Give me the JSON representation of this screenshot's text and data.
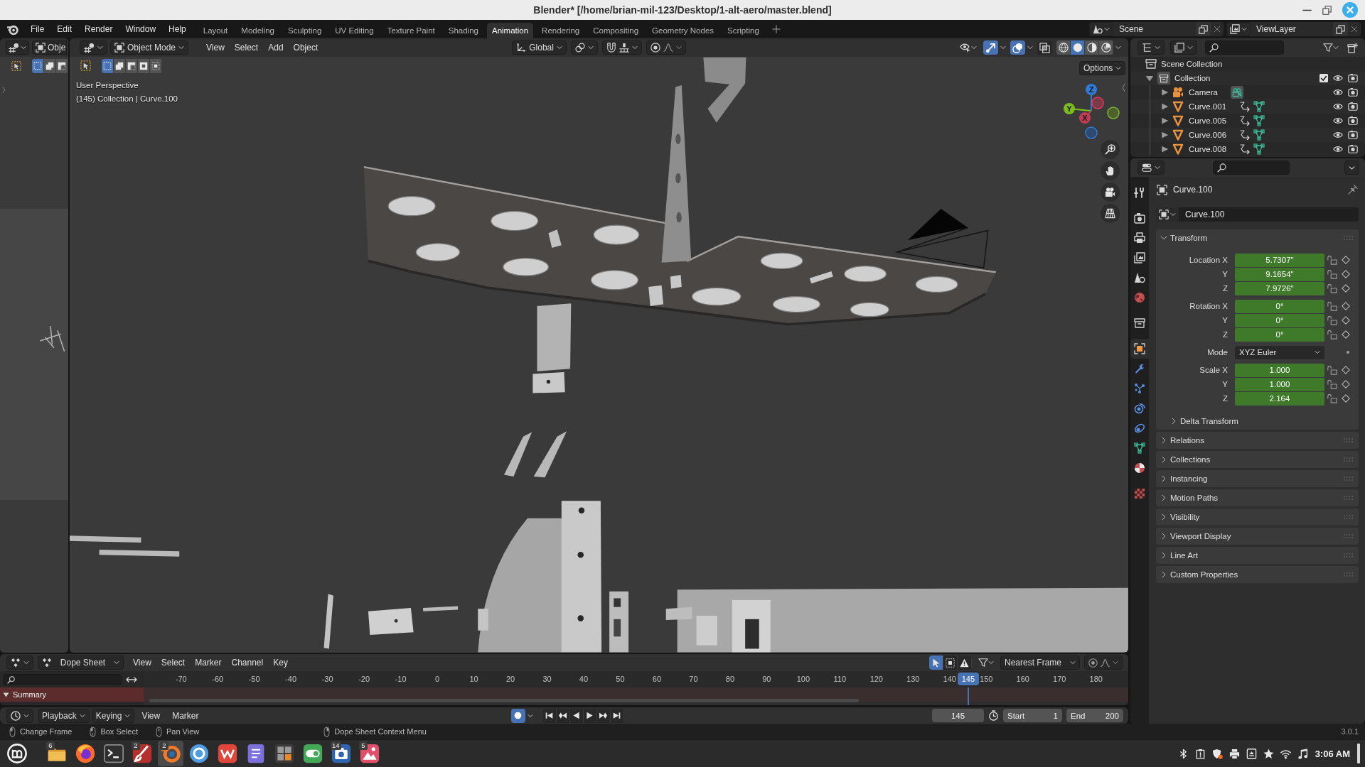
{
  "title_bar": {
    "title": "Blender* [/home/brian-mil-123/Desktop/1-alt-aero/master.blend]"
  },
  "top_bar": {
    "menus": [
      "File",
      "Edit",
      "Render",
      "Window",
      "Help"
    ],
    "workspaces": [
      {
        "label": "Layout",
        "selected": false
      },
      {
        "label": "Modeling",
        "selected": false
      },
      {
        "label": "Sculpting",
        "selected": false
      },
      {
        "label": "UV Editing",
        "selected": false
      },
      {
        "label": "Texture Paint",
        "selected": false
      },
      {
        "label": "Shading",
        "selected": false
      },
      {
        "label": "Animation",
        "selected": true
      },
      {
        "label": "Rendering",
        "selected": false
      },
      {
        "label": "Compositing",
        "selected": false
      },
      {
        "label": "Geometry Nodes",
        "selected": false
      },
      {
        "label": "Scripting",
        "selected": false
      }
    ],
    "scene": "Scene",
    "view_layer": "ViewLayer"
  },
  "side_viewport": {
    "mode": "Obje",
    "select_modes": [
      {
        "selected": true
      },
      {
        "selected": false
      },
      {
        "selected": false
      }
    ]
  },
  "viewport": {
    "mode": "Object Mode",
    "menus": [
      "View",
      "Select",
      "Add",
      "Object"
    ],
    "orientation": "Global",
    "select_modes": [
      {
        "selected": true
      },
      {
        "selected": false
      },
      {
        "selected": false
      },
      {
        "selected": false
      },
      {
        "selected": false
      }
    ],
    "gizmos": true,
    "overlays": true,
    "xray": false,
    "shading": [
      {
        "kind": "wireframe",
        "selected": false
      },
      {
        "kind": "solid",
        "selected": true
      },
      {
        "kind": "material",
        "selected": false
      },
      {
        "kind": "rendered",
        "selected": false
      }
    ],
    "options": "Options",
    "view_name": "User Perspective",
    "view_info": "(145) Collection | Curve.100",
    "axis_labels": [
      "Z",
      "Y",
      "X"
    ]
  },
  "outliner": {
    "root": "Scene Collection",
    "items": [
      {
        "name": "Collection",
        "kind": "collection",
        "expanded": true,
        "checked": true,
        "children": [
          {
            "name": "Camera",
            "kind": "camera",
            "expanded": false
          },
          {
            "name": "Curve.001",
            "kind": "curve",
            "expanded": false
          },
          {
            "name": "Curve.005",
            "kind": "curve",
            "expanded": false
          },
          {
            "name": "Curve.006",
            "kind": "curve",
            "expanded": false
          },
          {
            "name": "Curve.008",
            "kind": "curve",
            "expanded": false
          }
        ]
      }
    ]
  },
  "properties": {
    "tabs": [
      {
        "kind": "tool",
        "selected": false
      },
      {
        "kind": "render",
        "selected": false
      },
      {
        "kind": "output",
        "selected": false
      },
      {
        "kind": "view_layer",
        "selected": false
      },
      {
        "kind": "scene",
        "selected": false
      },
      {
        "kind": "world",
        "selected": false
      },
      {
        "kind": "collection",
        "selected": false
      },
      {
        "kind": "object",
        "selected": true
      },
      {
        "kind": "modifiers",
        "selected": false
      },
      {
        "kind": "particles",
        "selected": false
      },
      {
        "kind": "physics",
        "selected": false
      },
      {
        "kind": "constraints",
        "selected": false
      },
      {
        "kind": "data",
        "selected": false
      },
      {
        "kind": "material",
        "selected": false
      },
      {
        "kind": "texture",
        "selected": false
      }
    ],
    "object_name": "Curve.100",
    "name_field": "Curve.100",
    "transform": {
      "title": "Transform",
      "expanded": true,
      "groups": [
        {
          "rows": [
            {
              "label": "Location X",
              "value": "5.7307\"",
              "kind": "number"
            },
            {
              "label": "Y",
              "value": "9.1654\"",
              "kind": "number"
            },
            {
              "label": "Z",
              "value": "7.9726\"",
              "kind": "number"
            }
          ]
        },
        {
          "rows": [
            {
              "label": "Rotation X",
              "value": "0°",
              "kind": "number"
            },
            {
              "label": "Y",
              "value": "0°",
              "kind": "number"
            },
            {
              "label": "Z",
              "value": "0°",
              "kind": "number"
            }
          ]
        },
        {
          "rows": [
            {
              "label": "Mode",
              "value": "XYZ Euler",
              "kind": "dropdown"
            }
          ]
        },
        {
          "rows": [
            {
              "label": "Scale X",
              "value": "1.000",
              "kind": "number"
            },
            {
              "label": "Y",
              "value": "1.000",
              "kind": "number"
            },
            {
              "label": "Z",
              "value": "2.164",
              "kind": "number"
            }
          ]
        }
      ],
      "subpanels": [
        {
          "title": "Delta Transform",
          "expanded": false
        }
      ]
    },
    "panels": [
      {
        "title": "Relations",
        "expanded": false
      },
      {
        "title": "Collections",
        "expanded": false
      },
      {
        "title": "Instancing",
        "expanded": false
      },
      {
        "title": "Motion Paths",
        "expanded": false
      },
      {
        "title": "Visibility",
        "expanded": false
      },
      {
        "title": "Viewport Display",
        "expanded": false
      },
      {
        "title": "Line Art",
        "expanded": false
      },
      {
        "title": "Custom Properties",
        "expanded": false
      }
    ]
  },
  "dope_sheet": {
    "mode": "Dope Sheet",
    "menus": [
      "View",
      "Select",
      "Marker",
      "Channel",
      "Key"
    ],
    "only_selected": true,
    "snap": "Nearest Frame",
    "channels": [
      {
        "name": "Summary",
        "expanded": true
      }
    ],
    "ruler": [
      "-70",
      "-60",
      "-50",
      "-40",
      "-30",
      "-20",
      "-10",
      "0",
      "10",
      "20",
      "30",
      "40",
      "50",
      "60",
      "70",
      "80",
      "90",
      "100",
      "110",
      "120",
      "130",
      "140",
      "150",
      "160",
      "170",
      "180"
    ],
    "playhead": {
      "label": "145",
      "level": 0.8375
    }
  },
  "timeline": {
    "menus": [
      {
        "label": "Playback",
        "kind": "dropdown"
      },
      {
        "label": "Keying",
        "kind": "dropdown"
      },
      {
        "label": "View",
        "kind": "menu"
      },
      {
        "label": "Marker",
        "kind": "menu"
      }
    ],
    "auto_keying": true,
    "current_frame": "145",
    "start_label": "Start",
    "start": "1",
    "end_label": "End",
    "end": "200"
  },
  "status_bar": {
    "hints": [
      {
        "kind": "left_click",
        "label": "Change Frame"
      },
      {
        "kind": "left_drag",
        "label": "Box Select"
      },
      {
        "kind": "middle_drag",
        "label": "Pan View"
      },
      {
        "kind": "right_click",
        "label": "Dope Sheet Context Menu"
      }
    ],
    "version": "3.0.1"
  },
  "taskbar": {
    "apps": [
      {
        "kind": "folder",
        "badge": "6",
        "selected": false
      },
      {
        "kind": "flame",
        "selected": false
      },
      {
        "kind": "terminal",
        "selected": false
      },
      {
        "kind": "brush",
        "badge": "2",
        "selected": false
      },
      {
        "kind": "ring",
        "badge": "2",
        "selected": true
      },
      {
        "kind": "circle",
        "selected": false
      },
      {
        "kind": "tile",
        "selected": false
      },
      {
        "kind": "document",
        "selected": false
      },
      {
        "kind": "calculator",
        "selected": false
      },
      {
        "kind": "toggle",
        "selected": false
      },
      {
        "kind": "camera",
        "badge": "14",
        "selected": false
      },
      {
        "kind": "picture",
        "badge": "5",
        "selected": false
      }
    ],
    "time": "3:06 AM"
  }
}
